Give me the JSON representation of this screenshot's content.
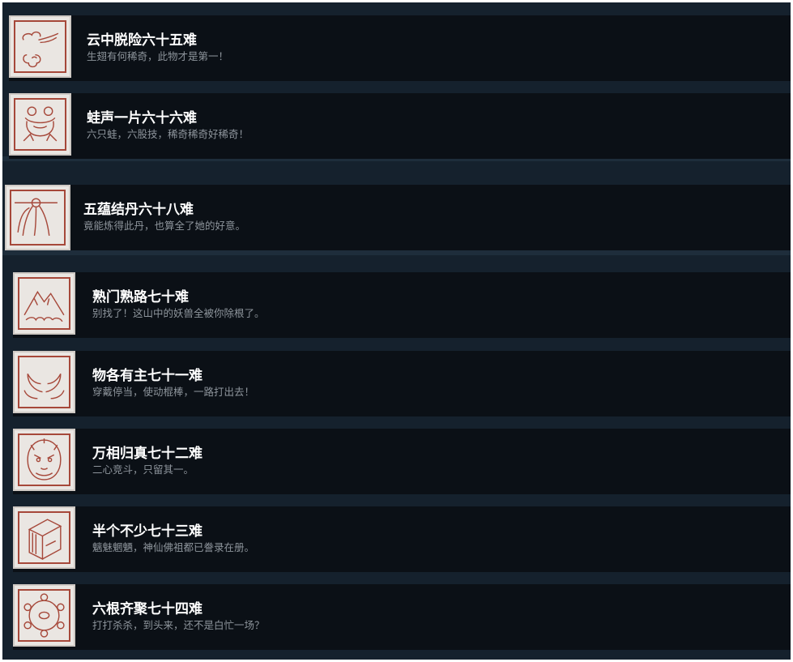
{
  "achievements": [
    {
      "title": "云中脱险六十五难",
      "desc": "生翅有何稀奇，此物才是第一！",
      "icon": "cloud-icon"
    },
    {
      "title": "蛙声一片六十六难",
      "desc": "六只蛙，六股技，稀奇稀奇好稀奇！",
      "icon": "frog-icon"
    },
    {
      "title": "五蕴结丹六十八难",
      "desc": "竟能炼得此丹，也算全了她的好意。",
      "icon": "hairpin-icon"
    },
    {
      "title": "熟门熟路七十难",
      "desc": "别找了！这山中的妖兽全被你除根了。",
      "icon": "mountain-icon"
    },
    {
      "title": "物各有主七十一难",
      "desc": "穿戴停当，使动棍棒，一路打出去！",
      "icon": "horns-icon"
    },
    {
      "title": "万相归真七十二难",
      "desc": "二心竞斗，只留其一。",
      "icon": "monkey-face-icon"
    },
    {
      "title": "半个不少七十三难",
      "desc": "魑魅魍魉，神仙佛祖都已誊录在册。",
      "icon": "book-icon"
    },
    {
      "title": "六根齐聚七十四难",
      "desc": "打打杀杀，到头来，还不是白忙一场？",
      "icon": "six-roots-icon"
    }
  ],
  "colors": {
    "row_bg": "#0b1016",
    "panel_bg": "#15212d",
    "icon_red": "#a6483a",
    "title": "#ffffff",
    "desc": "#8e959c"
  }
}
